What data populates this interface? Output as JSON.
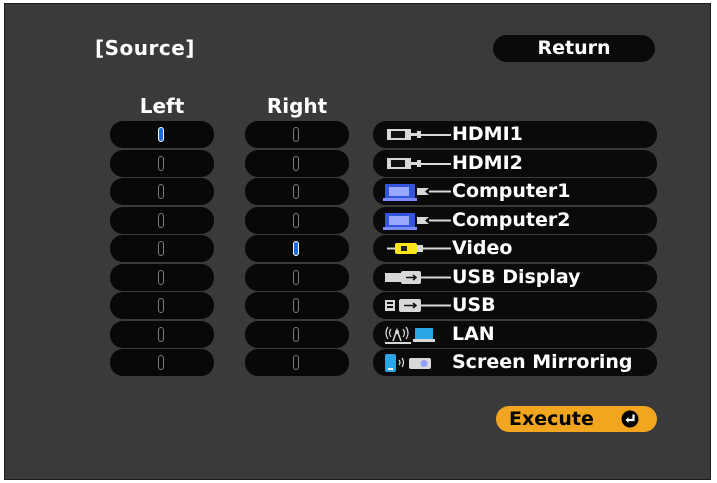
{
  "header": {
    "title": "[Source]",
    "return_label": "Return"
  },
  "columns": {
    "left": "Left",
    "right": "Right"
  },
  "selection": {
    "left_index": 0,
    "right_index": 4
  },
  "sources": [
    {
      "label": "HDMI1",
      "icon": "hdmi-icon"
    },
    {
      "label": "HDMI2",
      "icon": "hdmi-icon"
    },
    {
      "label": "Computer1",
      "icon": "vga-computer-icon"
    },
    {
      "label": "Computer2",
      "icon": "vga-computer-icon"
    },
    {
      "label": "Video",
      "icon": "video-rca-icon"
    },
    {
      "label": "USB Display",
      "icon": "usb-display-icon"
    },
    {
      "label": "USB",
      "icon": "usb-icon"
    },
    {
      "label": "LAN",
      "icon": "lan-wireless-icon"
    },
    {
      "label": "Screen Mirroring",
      "icon": "screen-mirroring-icon"
    }
  ],
  "execute": {
    "label": "Execute",
    "icon": "enter-icon"
  },
  "colors": {
    "panel": "#3a3a3a",
    "selected": "#1e6ae6",
    "execute": "#f2a51f"
  }
}
